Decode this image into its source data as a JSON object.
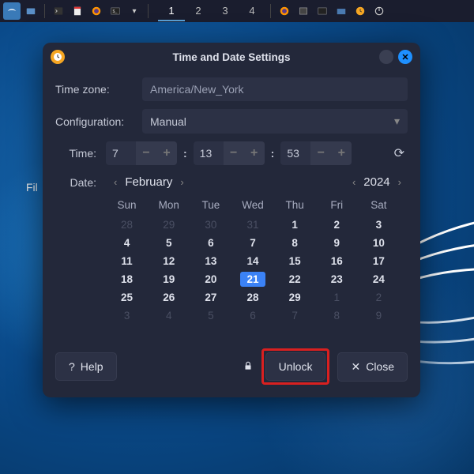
{
  "taskbar": {
    "workspaces": [
      "1",
      "2",
      "3",
      "4"
    ]
  },
  "desktop": {
    "truncated_label": "Fil"
  },
  "dialog": {
    "title": "Time and Date Settings",
    "timezone_label": "Time zone:",
    "timezone_value": "America/New_York",
    "config_label": "Configuration:",
    "config_value": "Manual",
    "time_label": "Time:",
    "time_h": "7",
    "time_m": "13",
    "time_s": "53",
    "date_label": "Date:",
    "month": "February",
    "year": "2024",
    "dow": [
      "Sun",
      "Mon",
      "Tue",
      "Wed",
      "Thu",
      "Fri",
      "Sat"
    ],
    "weeks": [
      [
        {
          "n": "28",
          "o": true
        },
        {
          "n": "29",
          "o": true
        },
        {
          "n": "30",
          "o": true
        },
        {
          "n": "31",
          "o": true
        },
        {
          "n": "1"
        },
        {
          "n": "2"
        },
        {
          "n": "3"
        }
      ],
      [
        {
          "n": "4"
        },
        {
          "n": "5"
        },
        {
          "n": "6"
        },
        {
          "n": "7"
        },
        {
          "n": "8"
        },
        {
          "n": "9"
        },
        {
          "n": "10"
        }
      ],
      [
        {
          "n": "11"
        },
        {
          "n": "12"
        },
        {
          "n": "13"
        },
        {
          "n": "14"
        },
        {
          "n": "15"
        },
        {
          "n": "16"
        },
        {
          "n": "17"
        }
      ],
      [
        {
          "n": "18"
        },
        {
          "n": "19"
        },
        {
          "n": "20"
        },
        {
          "n": "21",
          "sel": true
        },
        {
          "n": "22"
        },
        {
          "n": "23"
        },
        {
          "n": "24"
        }
      ],
      [
        {
          "n": "25"
        },
        {
          "n": "26"
        },
        {
          "n": "27"
        },
        {
          "n": "28"
        },
        {
          "n": "29"
        },
        {
          "n": "1",
          "o": true
        },
        {
          "n": "2",
          "o": true
        }
      ],
      [
        {
          "n": "3",
          "o": true
        },
        {
          "n": "4",
          "o": true
        },
        {
          "n": "5",
          "o": true
        },
        {
          "n": "6",
          "o": true
        },
        {
          "n": "7",
          "o": true
        },
        {
          "n": "8",
          "o": true
        },
        {
          "n": "9",
          "o": true
        }
      ]
    ],
    "help_label": "Help",
    "unlock_label": "Unlock",
    "close_label": "Close"
  }
}
